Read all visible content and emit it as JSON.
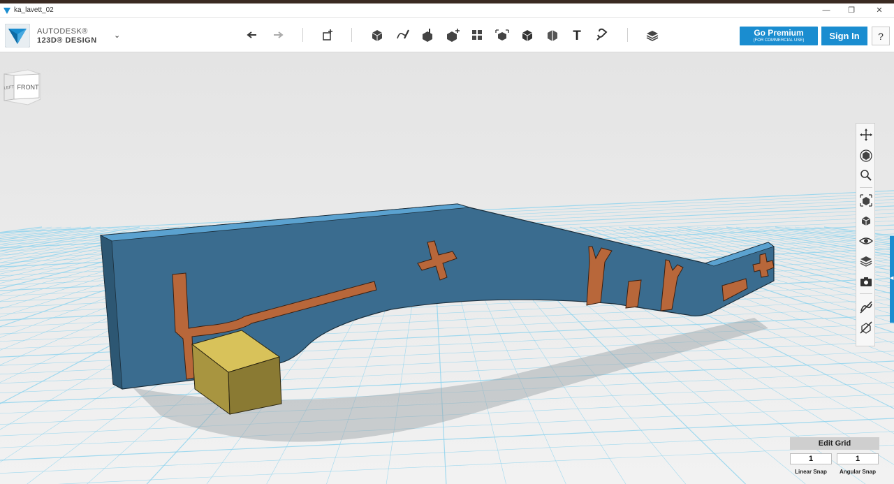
{
  "window": {
    "title": "ka_lavett_02",
    "minimize_glyph": "—",
    "restore_glyph": "❐",
    "close_glyph": "✕"
  },
  "brand": {
    "line1": "AUTODESK®",
    "line2": "123D® DESIGN",
    "menu_glyph": "⌄"
  },
  "toolbar": {
    "tools": [
      {
        "name": "undo-icon"
      },
      {
        "name": "redo-icon"
      },
      {
        "name": "transform-icon"
      },
      {
        "name": "primitives-icon"
      },
      {
        "name": "sketch-icon"
      },
      {
        "name": "construct-icon"
      },
      {
        "name": "modify-icon"
      },
      {
        "name": "pattern-icon"
      },
      {
        "name": "grouping-icon"
      },
      {
        "name": "combine-icon"
      },
      {
        "name": "measure-icon"
      },
      {
        "name": "text-icon"
      },
      {
        "name": "snap-icon"
      },
      {
        "name": "material-icon"
      }
    ],
    "text_tool_glyph": "T",
    "premium_label": "Go Premium",
    "premium_sub": "(FOR COMMERCIAL USE)",
    "signin_label": "Sign In",
    "help_label": "?"
  },
  "viewcube": {
    "front_label": "FRONT",
    "left_label": "LEFT"
  },
  "navbar": {
    "items": [
      {
        "name": "pan-icon"
      },
      {
        "name": "orbit-icon"
      },
      {
        "name": "zoom-icon"
      },
      {
        "name": "fit-icon"
      },
      {
        "name": "perspective-icon"
      },
      {
        "name": "visibility-icon"
      },
      {
        "name": "material-view-icon"
      },
      {
        "name": "screenshot-icon"
      },
      {
        "name": "hide-sketch-icon"
      },
      {
        "name": "hide-mesh-icon"
      }
    ]
  },
  "grid": {
    "edit_label": "Edit Grid",
    "linear_value": "1",
    "angular_value": "1",
    "linear_label": "Linear Snap",
    "angular_label": "Angular Snap"
  },
  "colors": {
    "accent": "#1a8dd0",
    "part_blue": "#3a6c8f",
    "part_copper": "#b8673a",
    "box_gold": "#9a8a3a",
    "grid_line": "#8cd3ee"
  }
}
